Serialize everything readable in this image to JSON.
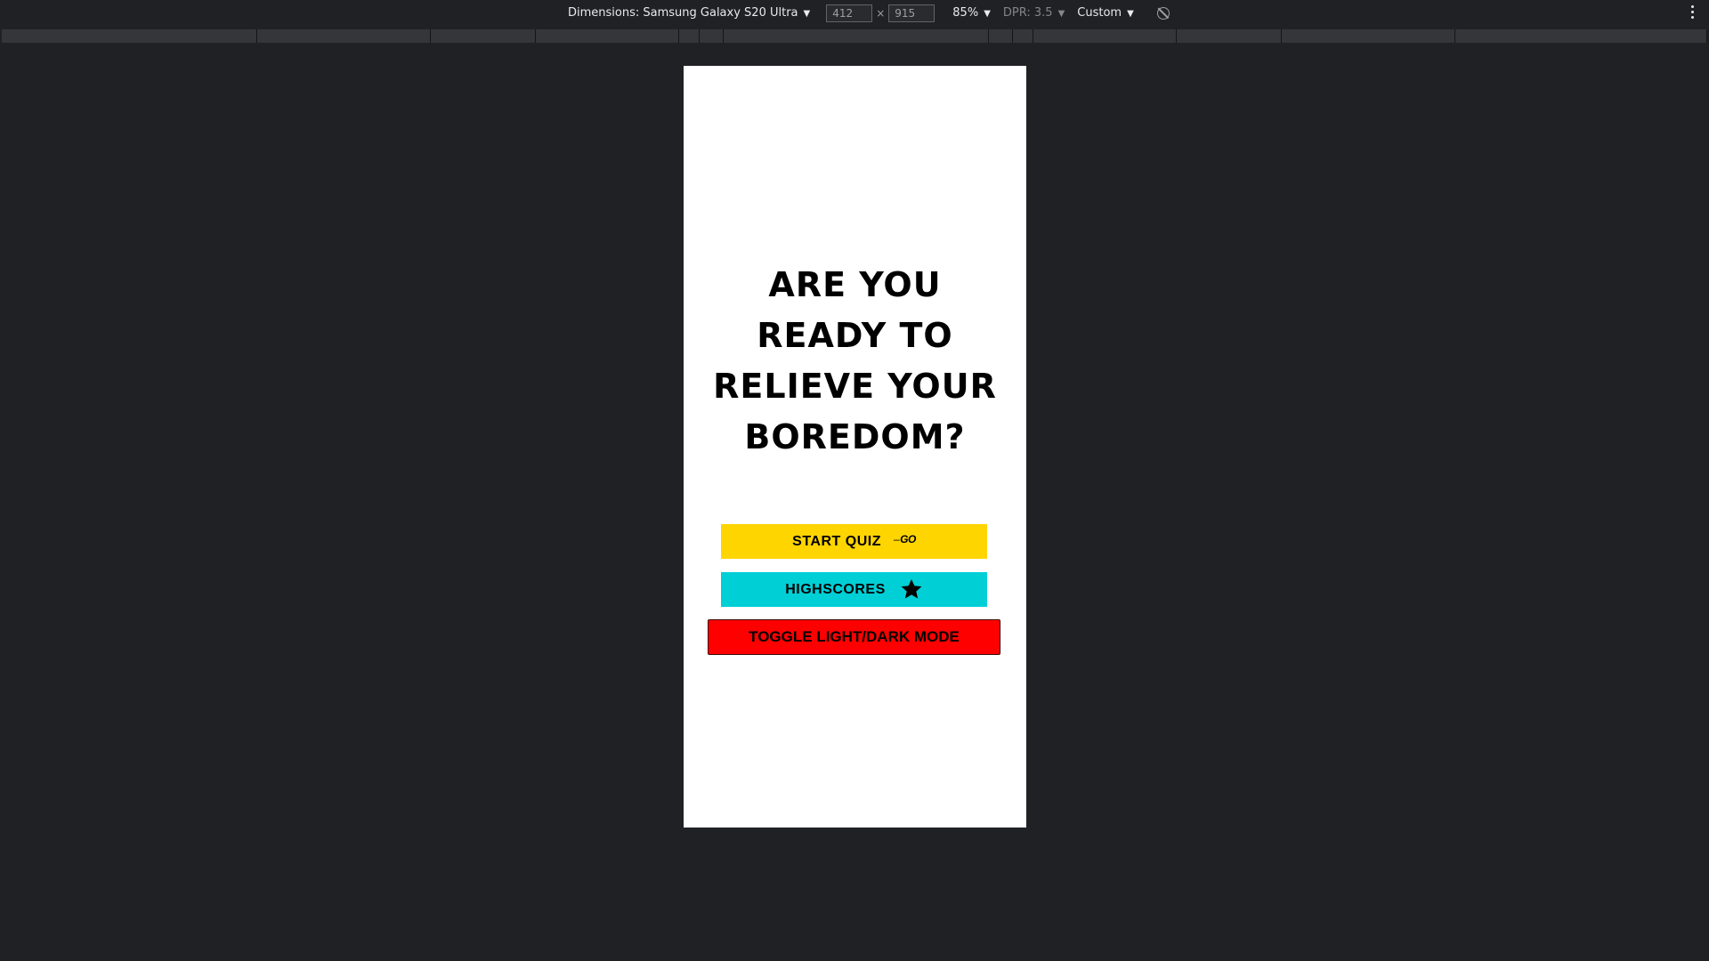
{
  "devtools": {
    "dimensions_label": "Dimensions: Samsung Galaxy S20 Ultra",
    "width_value": "412",
    "height_value": "915",
    "times_sign": "×",
    "zoom": "85%",
    "dpr": "DPR: 3.5",
    "throttle": "Custom",
    "icons": [
      "caret-down-icon",
      "rotate-icon",
      "kebab-menu-icon"
    ]
  },
  "page": {
    "headline_lines": [
      "ARE YOU",
      "READY TO",
      "RELIEVE YOUR",
      "BOREDOM?"
    ],
    "start_button": {
      "label": "START QUIZ",
      "icon_text": "GO",
      "color": "#ffd500"
    },
    "highscores_button": {
      "label": "HIGHSCORES",
      "icon": "star-icon",
      "color": "#00cfd6"
    },
    "toggle_button": {
      "label": "TOGGLE LIGHT/DARK MODE",
      "color": "#ff0000"
    }
  },
  "colors": {
    "chrome_background": "#202124",
    "viewport_background": "#ffffff"
  }
}
